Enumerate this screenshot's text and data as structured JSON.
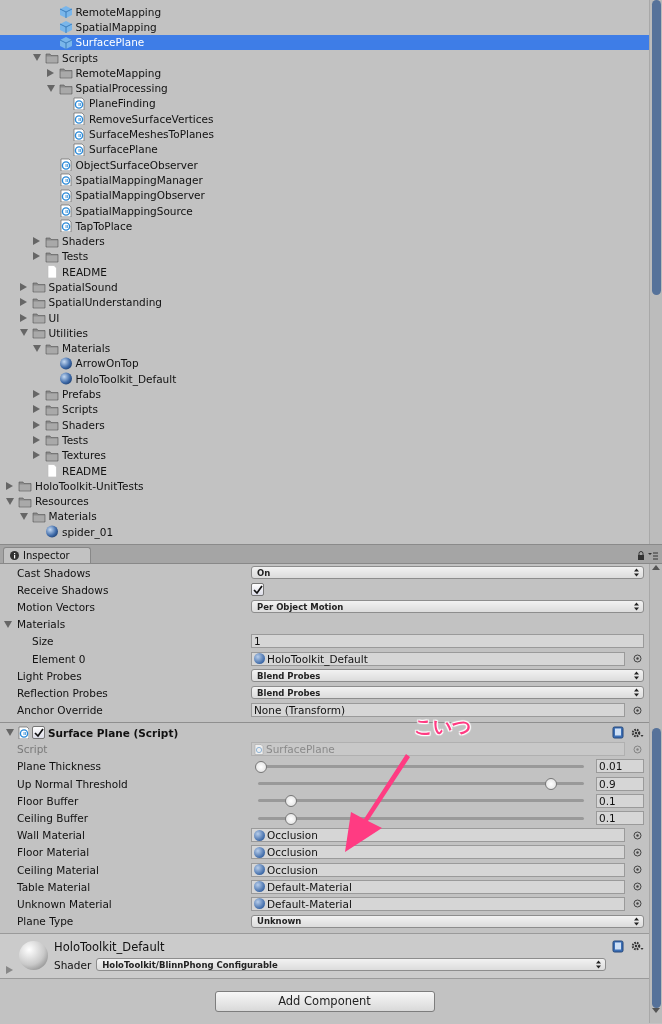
{
  "project_tree": {
    "items": [
      {
        "children": [
          {
            "children": [
              {
                "children": [
                  {
                    "label": "RemoteMapping",
                    "kind": "prefab",
                    "selected": false
                  },
                  {
                    "label": "SpatialMapping",
                    "kind": "prefab",
                    "selected": false
                  },
                  {
                    "label": "SurfacePlane",
                    "kind": "prefab",
                    "selected": true
                  }
                ]
              },
              {
                "label": "Scripts",
                "kind": "folder",
                "expanded": true,
                "selected": false,
                "children": [
                  {
                    "label": "RemoteMapping",
                    "kind": "folder",
                    "expanded": false,
                    "selected": false
                  },
                  {
                    "label": "SpatialProcessing",
                    "kind": "folder",
                    "expanded": true,
                    "selected": false,
                    "children": [
                      {
                        "label": "PlaneFinding",
                        "kind": "script",
                        "selected": false
                      },
                      {
                        "label": "RemoveSurfaceVertices",
                        "kind": "script",
                        "selected": false
                      },
                      {
                        "label": "SurfaceMeshesToPlanes",
                        "kind": "script",
                        "selected": false
                      },
                      {
                        "label": "SurfacePlane",
                        "kind": "script",
                        "selected": false
                      }
                    ]
                  },
                  {
                    "label": "ObjectSurfaceObserver",
                    "kind": "script",
                    "selected": false
                  },
                  {
                    "label": "SpatialMappingManager",
                    "kind": "script",
                    "selected": false
                  },
                  {
                    "label": "SpatialMappingObserver",
                    "kind": "script",
                    "selected": false
                  },
                  {
                    "label": "SpatialMappingSource",
                    "kind": "script",
                    "selected": false
                  },
                  {
                    "label": "TapToPlace",
                    "kind": "script",
                    "selected": false
                  }
                ]
              },
              {
                "label": "Shaders",
                "kind": "folder",
                "expanded": false,
                "selected": false
              },
              {
                "label": "Tests",
                "kind": "folder",
                "expanded": false,
                "selected": false
              },
              {
                "label": "README",
                "kind": "text",
                "selected": false
              }
            ]
          },
          {
            "label": "SpatialSound",
            "kind": "folder",
            "expanded": false,
            "selected": false
          },
          {
            "label": "SpatialUnderstanding",
            "kind": "folder",
            "expanded": false,
            "selected": false
          },
          {
            "label": "UI",
            "kind": "folder",
            "expanded": false,
            "selected": false
          },
          {
            "label": "Utilities",
            "kind": "folder",
            "expanded": true,
            "selected": false,
            "children": [
              {
                "label": "Materials",
                "kind": "folder",
                "expanded": true,
                "selected": false,
                "children": [
                  {
                    "label": "ArrowOnTop",
                    "kind": "material",
                    "selected": false
                  },
                  {
                    "label": "HoloToolkit_Default",
                    "kind": "material",
                    "selected": false
                  }
                ]
              },
              {
                "label": "Prefabs",
                "kind": "folder",
                "expanded": false,
                "selected": false
              },
              {
                "label": "Scripts",
                "kind": "folder",
                "expanded": false,
                "selected": false
              },
              {
                "label": "Shaders",
                "kind": "folder",
                "expanded": false,
                "selected": false
              },
              {
                "label": "Tests",
                "kind": "folder",
                "expanded": false,
                "selected": false
              },
              {
                "label": "Textures",
                "kind": "folder",
                "expanded": false,
                "selected": false
              },
              {
                "label": "README",
                "kind": "text",
                "selected": false
              }
            ]
          }
        ]
      },
      {
        "label": "HoloToolkit-UnitTests",
        "kind": "folder",
        "expanded": false,
        "selected": false
      },
      {
        "label": "Resources",
        "kind": "folder",
        "expanded": true,
        "selected": false,
        "children": [
          {
            "label": "Materials",
            "kind": "folder",
            "expanded": true,
            "selected": false,
            "children": [
              {
                "label": "spider_01",
                "kind": "material",
                "selected": false
              }
            ]
          }
        ]
      }
    ]
  },
  "inspector": {
    "tab": "Inspector",
    "renderer_properties": [
      {
        "kind": "dropdown",
        "label": "Cast Shadows",
        "value": "On"
      },
      {
        "kind": "checkbox",
        "label": "Receive Shadows",
        "checked": true
      },
      {
        "kind": "dropdown",
        "label": "Motion Vectors",
        "value": "Per Object Motion"
      },
      {
        "kind": "foldout",
        "label": "Materials",
        "expanded": true,
        "children": [
          {
            "kind": "number",
            "label": "Size",
            "value": "1"
          },
          {
            "kind": "object",
            "label": "Element 0",
            "value": "HoloToolkit_Default",
            "icon": true
          }
        ]
      },
      {
        "kind": "dropdown",
        "label": "Light Probes",
        "value": "Blend Probes"
      },
      {
        "kind": "dropdown",
        "label": "Reflection Probes",
        "value": "Blend Probes"
      },
      {
        "kind": "object",
        "label": "Anchor Override",
        "value": "None (Transform)",
        "icon": false
      }
    ],
    "component": {
      "title": "Surface Plane (Script)",
      "expanded": true,
      "enabled": true,
      "properties": [
        {
          "kind": "script",
          "label": "Script",
          "value": "SurfacePlane"
        },
        {
          "kind": "slider",
          "label": "Plane Thickness",
          "level": 0.01,
          "value": "0.01"
        },
        {
          "kind": "slider",
          "label": "Up Normal Threshold",
          "level": 0.9,
          "value": "0.9"
        },
        {
          "kind": "slider",
          "label": "Floor Buffer",
          "level": 0.1,
          "value": "0.1"
        },
        {
          "kind": "slider",
          "label": "Ceiling Buffer",
          "level": 0.1,
          "value": "0.1"
        },
        {
          "kind": "object",
          "label": "Wall Material",
          "value": "Occlusion",
          "icon": true
        },
        {
          "kind": "object",
          "label": "Floor Material",
          "value": "Occlusion",
          "icon": true
        },
        {
          "kind": "object",
          "label": "Ceiling Material",
          "value": "Occlusion",
          "icon": true
        },
        {
          "kind": "object",
          "label": "Table Material",
          "value": "Default-Material",
          "icon": true
        },
        {
          "kind": "object",
          "label": "Unknown Material",
          "value": "Default-Material",
          "icon": true
        },
        {
          "kind": "dropdown",
          "label": "Plane Type",
          "value": "Unknown"
        }
      ]
    },
    "material": {
      "name": "HoloToolkit_Default",
      "expanded": false,
      "shader_label": "Shader",
      "shader": "HoloToolkit/BlinnPhong Configurable"
    },
    "add_button": "Add Component"
  },
  "annotation": {
    "text": "こいつ"
  }
}
